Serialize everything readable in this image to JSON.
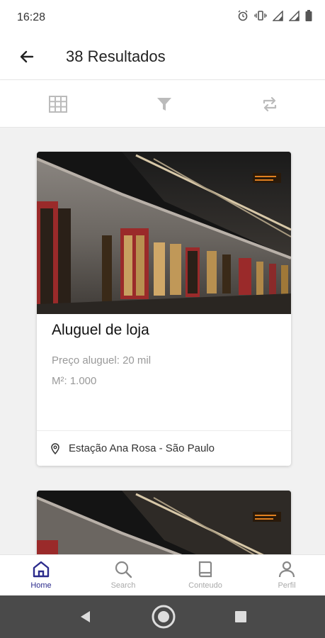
{
  "status_bar": {
    "time": "16:28"
  },
  "header": {
    "title": "38 Resultados"
  },
  "toolbar": {
    "icons": [
      "grid-icon",
      "filter-icon",
      "swap-icon"
    ]
  },
  "listings": [
    {
      "title": "Aluguel de loja",
      "price": "Preço aluguel: 20 mil",
      "area": "M²: 1.000",
      "location": "Estação Ana Rosa - São Paulo"
    }
  ],
  "bottom_nav": {
    "active": "Home",
    "items": [
      {
        "label": "Home",
        "icon": "home-icon"
      },
      {
        "label": "Search",
        "icon": "search-icon"
      },
      {
        "label": "Conteudo",
        "icon": "book-icon"
      },
      {
        "label": "Perfil",
        "icon": "person-icon"
      }
    ]
  },
  "colors": {
    "accent": "#2b2b8c",
    "background": "#f1f1f1",
    "system_nav": "#4a4a4a"
  }
}
